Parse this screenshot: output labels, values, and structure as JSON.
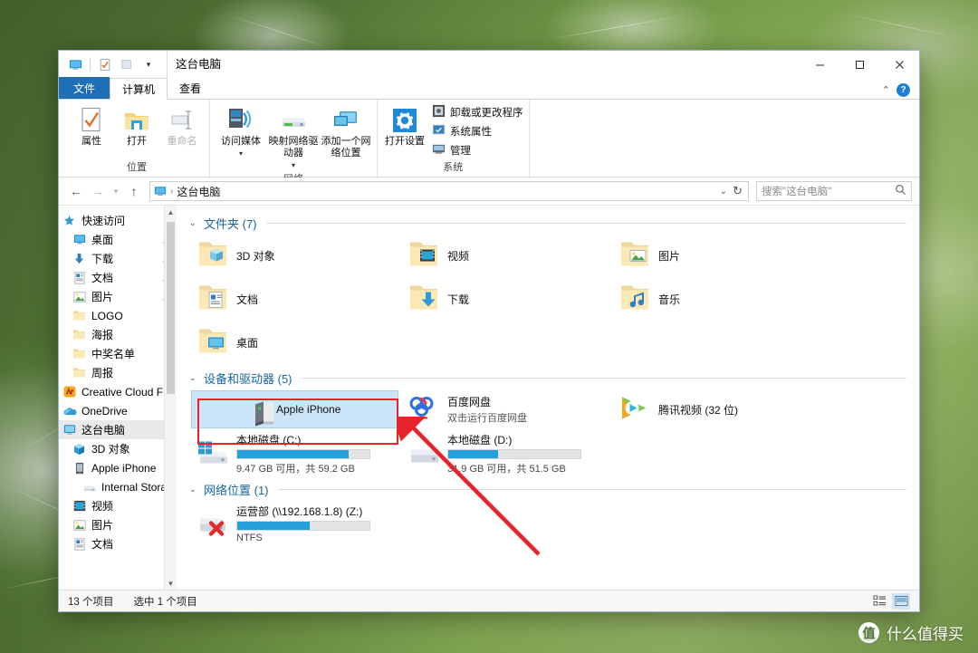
{
  "window": {
    "title": "这台电脑",
    "quick_access_icons": [
      "monitor-icon",
      "properties-icon",
      "new-folder-icon"
    ],
    "dropdown_caret": "▾",
    "controls": {
      "minimize": "—",
      "maximize": "☐",
      "close": "✕"
    },
    "ribbon_collapse": "⌃",
    "help": "?"
  },
  "tabs": [
    {
      "id": "file",
      "label": "文件"
    },
    {
      "id": "computer",
      "label": "计算机"
    },
    {
      "id": "view",
      "label": "查看"
    }
  ],
  "ribbon": {
    "groups": [
      {
        "label": "位置",
        "buttons": [
          {
            "name": "properties",
            "label": "属性",
            "icon": "properties-icon",
            "disabled": false
          },
          {
            "name": "open",
            "label": "打开",
            "icon": "open-folder-icon",
            "disabled": false
          },
          {
            "name": "rename",
            "label": "重命名",
            "icon": "rename-icon",
            "disabled": true
          }
        ]
      },
      {
        "label": "网络",
        "buttons": [
          {
            "name": "access-media",
            "label": "访问媒体",
            "icon": "media-server-icon",
            "disabled": false,
            "has_caret": true
          },
          {
            "name": "map-network-drive",
            "label": "映射网络驱动器",
            "icon": "map-drive-icon",
            "disabled": false,
            "has_caret": true
          },
          {
            "name": "add-network-location",
            "label": "添加一个网络位置",
            "icon": "add-network-icon",
            "disabled": false
          }
        ]
      },
      {
        "label": "系统",
        "buttons": [
          {
            "name": "open-settings",
            "label": "打开设置",
            "icon": "gear-icon",
            "disabled": false
          }
        ],
        "small_buttons": [
          {
            "name": "uninstall-change-program",
            "label": "卸载或更改程序",
            "icon": "uninstall-icon"
          },
          {
            "name": "system-properties",
            "label": "系统属性",
            "icon": "system-properties-icon"
          },
          {
            "name": "manage",
            "label": "管理",
            "icon": "manage-icon"
          }
        ]
      }
    ]
  },
  "navigation": {
    "back": "←",
    "forward": "→",
    "recent": "▾",
    "up": "↑",
    "breadcrumb_icon": "monitor-icon",
    "breadcrumb": "这台电脑",
    "breadcrumb_sep": "›",
    "dropdown": "⌄",
    "refresh": "↻",
    "search_placeholder": "搜索\"这台电脑\"",
    "search_value": "",
    "search_icon": "search-icon"
  },
  "sidebar": {
    "items": [
      {
        "label": "快速访问",
        "icon": "star-icon",
        "indent": 0,
        "pinned": false,
        "selected": false
      },
      {
        "label": "桌面",
        "icon": "desktop-icon",
        "indent": 1,
        "pinned": true,
        "selected": false
      },
      {
        "label": "下载",
        "icon": "download-icon",
        "indent": 1,
        "pinned": true,
        "selected": false
      },
      {
        "label": "文档",
        "icon": "document-icon",
        "indent": 1,
        "pinned": true,
        "selected": false
      },
      {
        "label": "图片",
        "icon": "pictures-icon",
        "indent": 1,
        "pinned": true,
        "selected": false
      },
      {
        "label": "LOGO",
        "icon": "folder-icon",
        "indent": 1,
        "pinned": false,
        "selected": false
      },
      {
        "label": "海报",
        "icon": "folder-icon",
        "indent": 1,
        "pinned": false,
        "selected": false
      },
      {
        "label": "中奖名单",
        "icon": "folder-icon",
        "indent": 1,
        "pinned": false,
        "selected": false
      },
      {
        "label": "周报",
        "icon": "folder-icon",
        "indent": 1,
        "pinned": false,
        "selected": false
      },
      {
        "label": "Creative Cloud F",
        "icon": "creative-cloud-icon",
        "indent": 0,
        "pinned": false,
        "selected": false
      },
      {
        "label": "OneDrive",
        "icon": "onedrive-icon",
        "indent": 0,
        "pinned": false,
        "selected": false
      },
      {
        "label": "这台电脑",
        "icon": "monitor-icon",
        "indent": 0,
        "pinned": false,
        "selected": true
      },
      {
        "label": "3D 对象",
        "icon": "3d-objects-icon",
        "indent": 1,
        "pinned": false,
        "selected": false
      },
      {
        "label": "Apple iPhone",
        "icon": "phone-icon",
        "indent": 1,
        "pinned": false,
        "selected": false
      },
      {
        "label": "Internal Stora",
        "icon": "internal-storage-icon",
        "indent": 2,
        "pinned": false,
        "selected": false
      },
      {
        "label": "视频",
        "icon": "videos-icon",
        "indent": 1,
        "pinned": false,
        "selected": false
      },
      {
        "label": "图片",
        "icon": "pictures-icon",
        "indent": 1,
        "pinned": false,
        "selected": false
      },
      {
        "label": "文档",
        "icon": "document-icon",
        "indent": 1,
        "pinned": false,
        "selected": false
      }
    ]
  },
  "content": {
    "sections": [
      {
        "id": "folders",
        "title": "文件夹 (7)",
        "chevron": "⌄",
        "items": [
          {
            "name": "3D 对象",
            "icon": "folder-3d-icon",
            "kind": "folder"
          },
          {
            "name": "视频",
            "icon": "folder-videos-icon",
            "kind": "folder"
          },
          {
            "name": "图片",
            "icon": "folder-pictures-icon",
            "kind": "folder"
          },
          {
            "name": "文档",
            "icon": "folder-documents-icon",
            "kind": "folder"
          },
          {
            "name": "下载",
            "icon": "folder-downloads-icon",
            "kind": "folder"
          },
          {
            "name": "音乐",
            "icon": "folder-music-icon",
            "kind": "folder"
          },
          {
            "name": "桌面",
            "icon": "folder-desktop-icon",
            "kind": "folder"
          }
        ]
      },
      {
        "id": "devices",
        "title": "设备和驱动器 (5)",
        "chevron": "⌄",
        "items": [
          {
            "name": "Apple iPhone",
            "icon": "phone-device-icon",
            "kind": "device",
            "selected": true
          },
          {
            "name": "百度网盘",
            "subtitle": "双击运行百度网盘",
            "icon": "baidu-netdisk-icon",
            "kind": "app"
          },
          {
            "name": "腾讯视频 (32 位)",
            "icon": "tencent-video-icon",
            "kind": "app"
          },
          {
            "name": "本地磁盘 (C:)",
            "icon": "windows-drive-icon",
            "kind": "drive",
            "free": "9.47 GB",
            "total": "59.2 GB",
            "usage_text": "9.47 GB 可用，共 59.2 GB",
            "used_percent": 84
          },
          {
            "name": "本地磁盘 (D:)",
            "icon": "drive-icon",
            "kind": "drive",
            "free": "31.9 GB",
            "total": "51.5 GB",
            "usage_text": "31.9 GB 可用，共 51.5 GB",
            "used_percent": 38
          }
        ]
      },
      {
        "id": "network",
        "title": "网络位置 (1)",
        "chevron": "⌄",
        "items": [
          {
            "name": "运营部 (\\\\192.168.1.8) (Z:)",
            "icon": "disconnected-network-drive-icon",
            "kind": "netdrive",
            "usage_text": "NTFS",
            "used_percent": 55
          }
        ]
      }
    ]
  },
  "statusbar": {
    "item_count": "13 个项目",
    "selection": "选中 1 个项目",
    "views": [
      {
        "name": "details-view",
        "icon": "details-view-icon",
        "active": false
      },
      {
        "name": "large-icons-view",
        "icon": "large-icons-view-icon",
        "active": true
      }
    ]
  },
  "annotations": {
    "highlight_box_target": "Apple iPhone",
    "arrow_color": "#e8232a",
    "box_color": "#e8232a"
  },
  "watermark": {
    "logo_text": "值",
    "text": "什么值得买"
  },
  "colors": {
    "accent_blue": "#1e6fb8",
    "link_blue": "#16659e",
    "selection_blue": "#cce4f7",
    "progress_blue": "#26a0da",
    "annotation_red": "#e8232a",
    "desktop_green": "#4e6d33"
  }
}
